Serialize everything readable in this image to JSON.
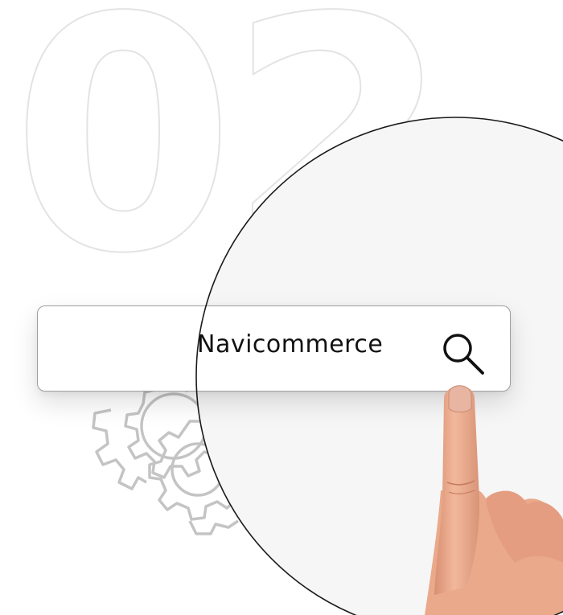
{
  "step_number": "02",
  "search": {
    "value": "Navicommerce"
  },
  "icons": {
    "search": "search-icon",
    "gears": "gears-icon",
    "finger": "pointing-finger"
  },
  "colors": {
    "outline": "#e3e3e3",
    "gear_stroke": "#c4c4c4",
    "lens_fill": "#f6f6f6",
    "lens_border": "#1a1a1a",
    "text": "#111111",
    "skin": "#e9a688"
  }
}
